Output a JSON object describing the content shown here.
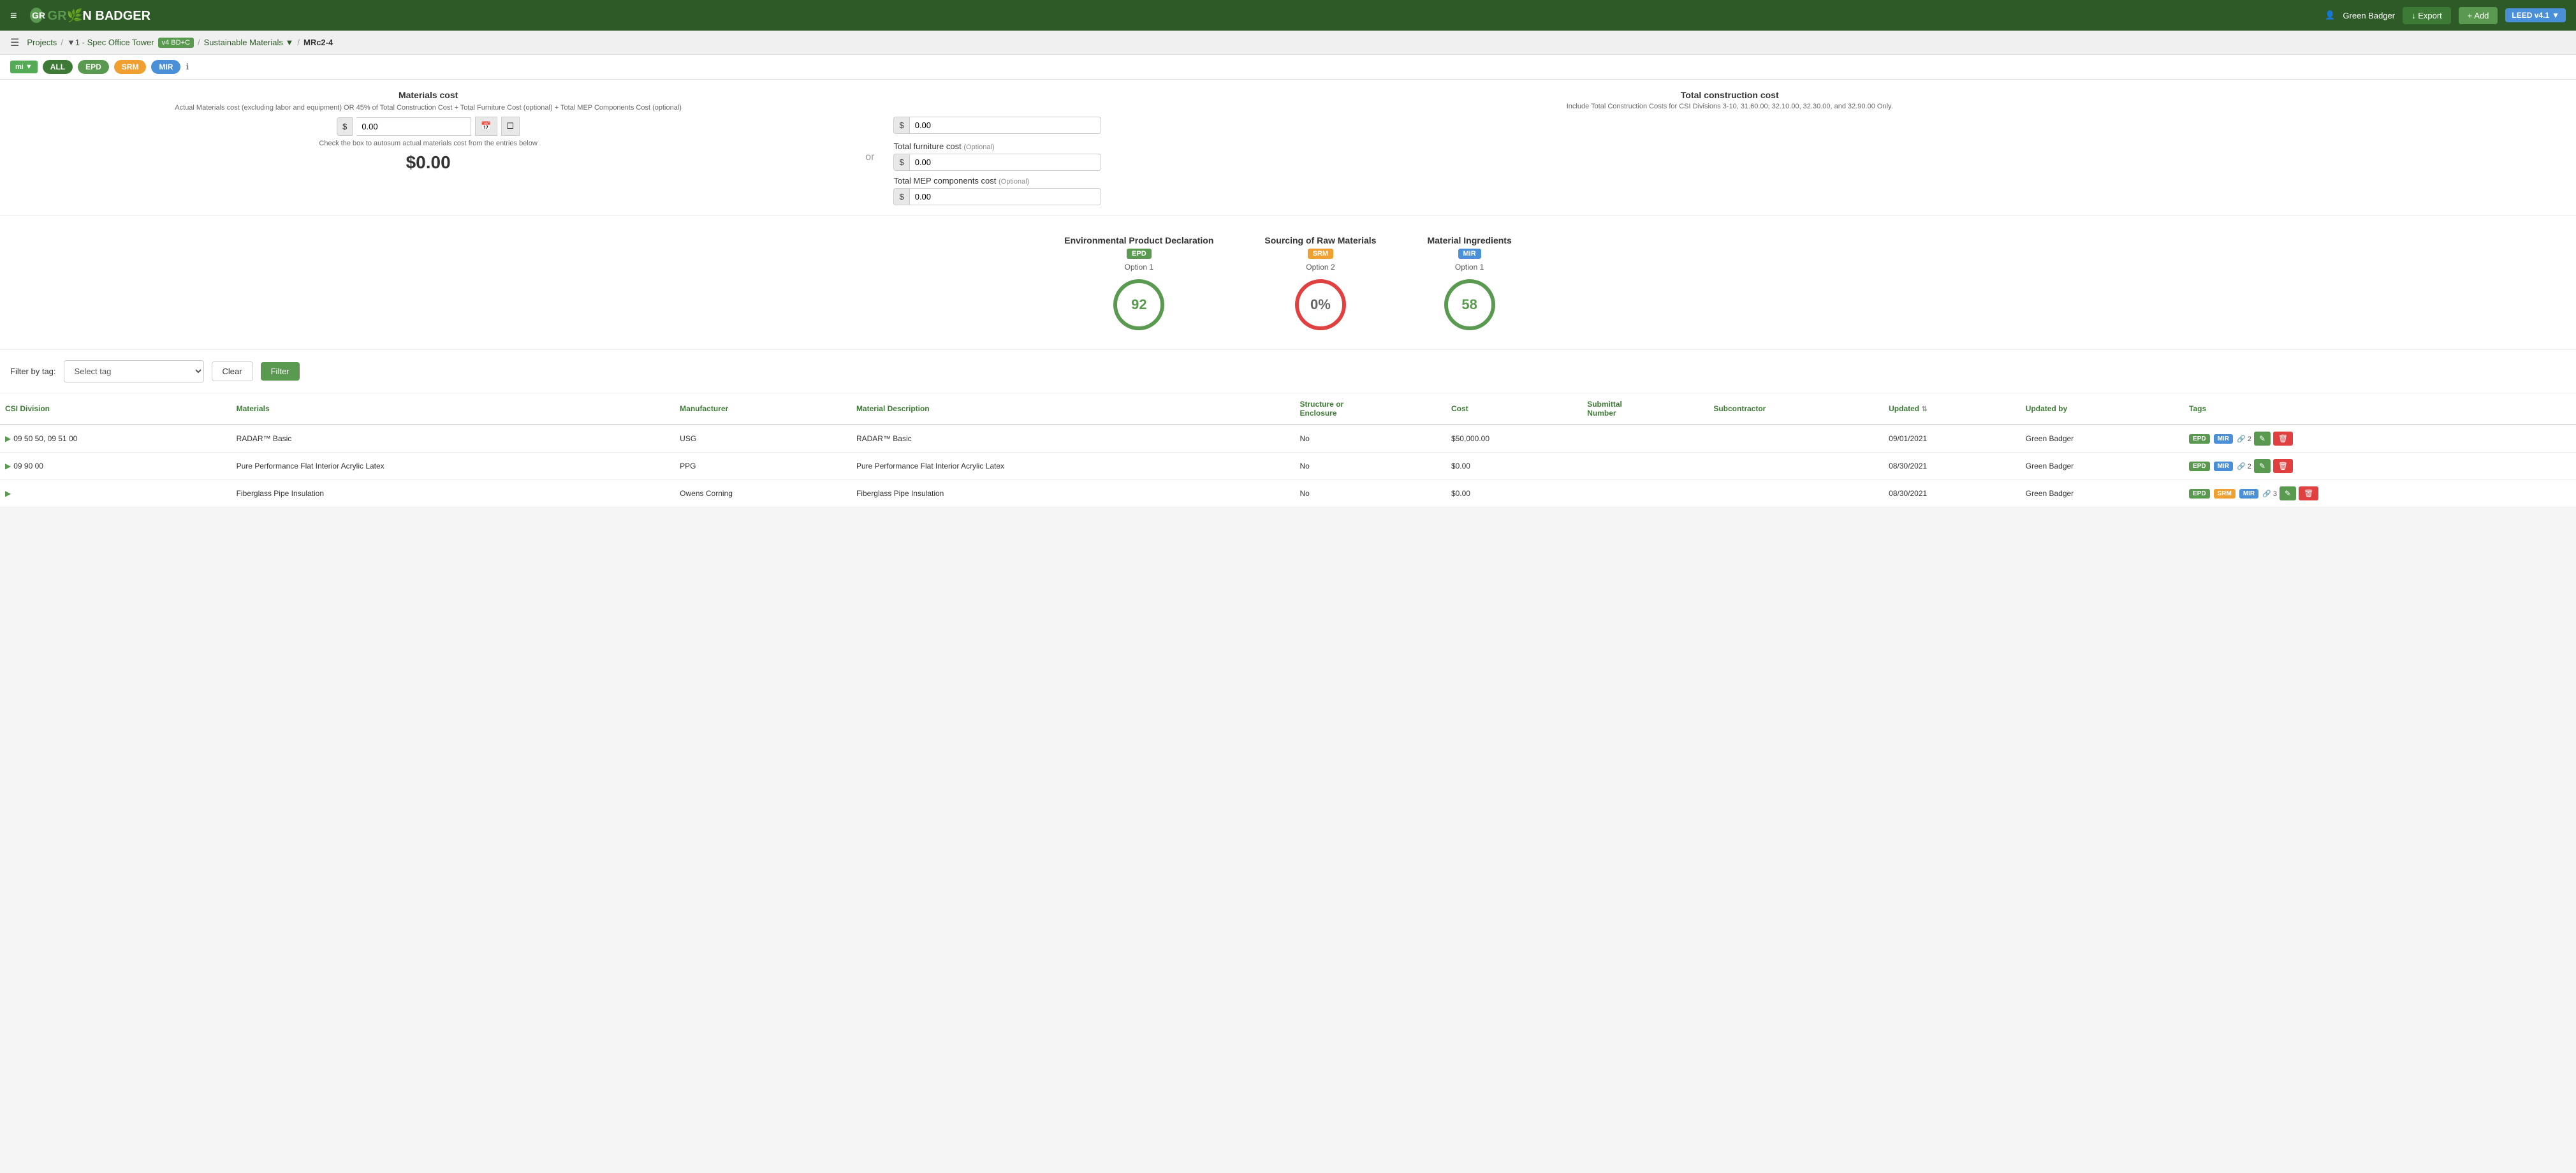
{
  "header": {
    "logo_text": "GR",
    "logo_leaf": "🌿",
    "logo_rest": "N BADGER",
    "user": "Green Badger",
    "hamburger": "≡"
  },
  "breadcrumb": {
    "projects": "Projects",
    "project_name": "1 - Spec Office Tower",
    "tag": "v4 BD+C",
    "category": "Sustainable Materials",
    "credit": "MRc2-4"
  },
  "nav_buttons": {
    "export": "↓ Export",
    "add": "+ Add"
  },
  "leed_badge": {
    "label": "LEED v4.1",
    "arrow": "▼"
  },
  "filter_pills": {
    "all": "ALL",
    "epd": "EPD",
    "srm": "SRM",
    "mir": "MIR"
  },
  "materials_cost": {
    "title": "Materials cost",
    "description": "Actual Materials cost (excluding labor and equipment) OR 45% of Total Construction Cost + Total Furniture Cost (optional) + Total MEP Components Cost (optional)",
    "total": "$0.00",
    "input_value": "0.00",
    "hint": "Check the box to autosum actual materials cost from the entries below"
  },
  "total_construction": {
    "title": "Total construction cost",
    "description": "Include Total Construction Costs for CSI Divisions 3-10, 31.60.00, 32.10.00, 32.30.00, and 32.90.00 Only.",
    "input_value": "0.00"
  },
  "total_furniture": {
    "label": "Total furniture cost",
    "optional": "(Optional)",
    "input_value": "0.00"
  },
  "total_mep": {
    "label": "Total MEP components cost",
    "optional": "(Optional)",
    "input_value": "0.00"
  },
  "gauges": [
    {
      "title": "Environmental Product Declaration",
      "badge": "EPD",
      "badge_class": "badge-epd",
      "option": "Option 1",
      "value": "92",
      "style": "gauge-green"
    },
    {
      "title": "Sourcing of Raw Materials",
      "badge": "SRM",
      "badge_class": "badge-srm",
      "option": "Option 2",
      "value": "0%",
      "style": "gauge-red"
    },
    {
      "title": "Material Ingredients",
      "badge": "MIR",
      "badge_class": "badge-mir",
      "option": "Option 1",
      "value": "58",
      "style": "gauge-green"
    }
  ],
  "tag_filter": {
    "label": "Filter by tag:",
    "placeholder": "Select tag",
    "clear_btn": "Clear",
    "filter_btn": "Filter"
  },
  "table": {
    "columns": [
      "CSI Division",
      "Materials",
      "Manufacturer",
      "Material Description",
      "Structure or Enclosure",
      "Cost",
      "Submittal Number",
      "Subcontractor",
      "Updated",
      "Updated by",
      "Tags"
    ],
    "rows": [
      {
        "csi": "09 50 50, 09 51 00",
        "material": "RADAR™ Basic",
        "manufacturer": "USG",
        "description": "RADAR™ Basic",
        "structure": "No",
        "cost": "$50,000.00",
        "submittal": "",
        "subcontractor": "",
        "updated": "09/01/2021",
        "updated_by": "Green Badger",
        "tags": [
          "EPD",
          "MIR"
        ],
        "links": "2"
      },
      {
        "csi": "09 90 00",
        "material": "Pure Performance Flat Interior Acrylic Latex",
        "manufacturer": "PPG",
        "description": "Pure Performance Flat Interior Acrylic Latex",
        "structure": "No",
        "cost": "$0.00",
        "submittal": "",
        "subcontractor": "",
        "updated": "08/30/2021",
        "updated_by": "Green Badger",
        "tags": [
          "EPD",
          "MIR"
        ],
        "links": "2"
      },
      {
        "csi": "",
        "material": "Fiberglass Pipe Insulation",
        "manufacturer": "Owens Corning",
        "description": "Fiberglass Pipe Insulation",
        "structure": "No",
        "cost": "$0.00",
        "submittal": "",
        "subcontractor": "",
        "updated": "08/30/2021",
        "updated_by": "Green Badger",
        "tags": [
          "EPD",
          "SRM",
          "MIR"
        ],
        "links": "3"
      }
    ]
  }
}
